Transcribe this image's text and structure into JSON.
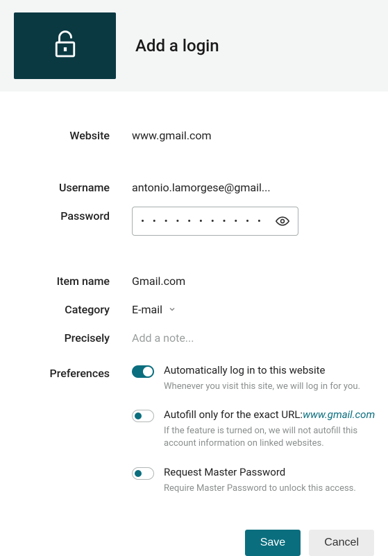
{
  "header": {
    "title": "Add a login"
  },
  "fields": {
    "website": {
      "label": "Website",
      "value": "www.gmail.com"
    },
    "username": {
      "label": "Username",
      "value": "antonio.lamorgese@gmail..."
    },
    "password": {
      "label": "Password",
      "masked": "• • • • • • • • • • •"
    },
    "item_name": {
      "label": "Item name",
      "value": "Gmail.com"
    },
    "category": {
      "label": "Category",
      "value": "E-mail"
    },
    "precisely": {
      "label": "Precisely",
      "placeholder": "Add a note..."
    }
  },
  "preferences": {
    "label": "Preferences",
    "items": [
      {
        "title": "Automatically log in to this website",
        "desc": "Whenever you visit this site, we will log in for you.",
        "toggle_style": "on-filled"
      },
      {
        "title_prefix": "Autofill only for the exact URL:",
        "title_url": "www.gmail.com",
        "desc": "If the feature is turned on, we will not autofill this account information on linked websites.",
        "toggle_style": "on-outline"
      },
      {
        "title": "Request Master Password",
        "desc": "Require Master Password to unlock this access.",
        "toggle_style": "on-outline"
      }
    ]
  },
  "buttons": {
    "save": "Save",
    "cancel": "Cancel"
  }
}
